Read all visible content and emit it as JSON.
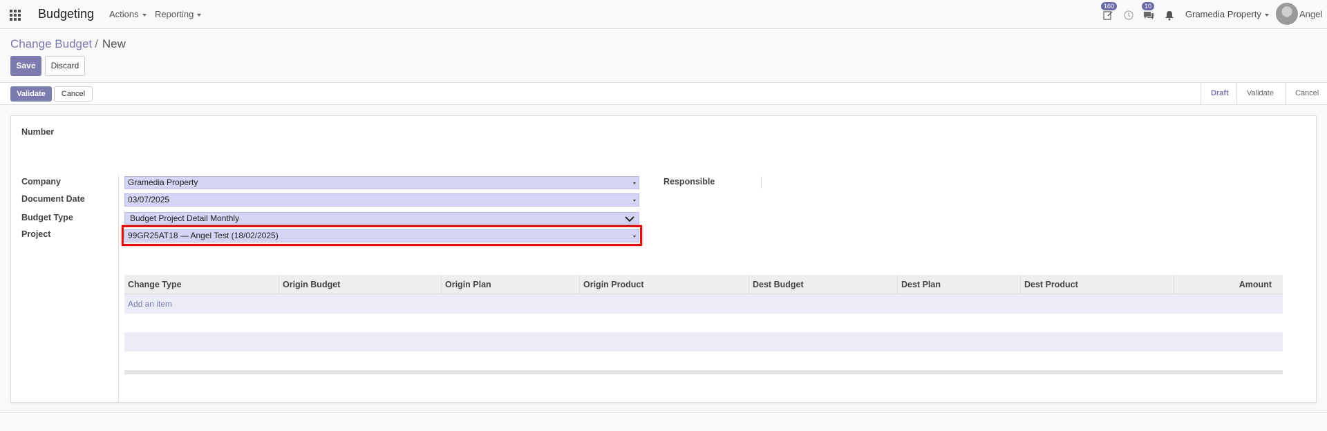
{
  "navbar": {
    "app_name": "Budgeting",
    "menus": [
      "Actions",
      "Reporting"
    ],
    "activity_badge": "160",
    "messages_badge": "10",
    "company": "Gramedia Property",
    "user": "Angel"
  },
  "breadcrumb": {
    "parent": "Change Budget",
    "separator": "/",
    "current": "New"
  },
  "control_panel": {
    "save_label": "Save",
    "discard_label": "Discard"
  },
  "status_bar": {
    "validate_label": "Validate",
    "cancel_label": "Cancel",
    "stages": [
      "Draft",
      "Validate",
      "Cancel"
    ],
    "current_stage": "Draft"
  },
  "form": {
    "number_label": "Number",
    "company_label": "Company",
    "company_value": "Gramedia Property",
    "document_date_label": "Document Date",
    "document_date_value": "03/07/2025",
    "budget_type_label": "Budget Type",
    "budget_type_value": "Budget Project Detail Monthly",
    "project_label": "Project",
    "project_value": "99GR25AT18 — Angel Test (18/02/2025)",
    "responsible_label": "Responsible"
  },
  "lines_table": {
    "columns": [
      "Change Type",
      "Origin Budget",
      "Origin Plan",
      "Origin Product",
      "Dest Budget",
      "Dest Plan",
      "Dest Product",
      "Amount"
    ],
    "add_item_label": "Add an item"
  },
  "colors": {
    "brand": "#7c7bad",
    "field_bg": "#d4d4f5",
    "highlight": "#e01010"
  }
}
